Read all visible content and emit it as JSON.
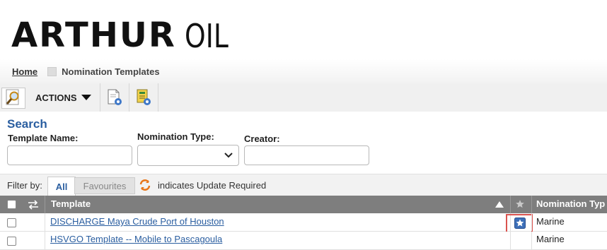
{
  "brand": {
    "name_bold": "ARTHUR",
    "name_light": "OIL"
  },
  "breadcrumb": {
    "home": "Home",
    "current": "Nomination Templates"
  },
  "toolbar": {
    "actions_label": "ACTIONS"
  },
  "search": {
    "title": "Search",
    "template_name_label": "Template Name:",
    "template_name_value": "",
    "nomination_type_label": "Nomination Type:",
    "nomination_type_value": "",
    "creator_label": "Creator:",
    "creator_value": ""
  },
  "filter": {
    "label": "Filter by:",
    "all": "All",
    "favourites": "Favourites",
    "update_note": "indicates Update Required"
  },
  "table": {
    "columns": {
      "template": "Template",
      "nomination_type": "Nomination Typ"
    },
    "rows": [
      {
        "template": "DISCHARGE Maya Crude Port of Houston",
        "nomination_type": "Marine",
        "favourite": true
      },
      {
        "template": "HSVGO Template -- Mobile to Pascagoula",
        "nomination_type": "Marine",
        "favourite": false
      }
    ]
  },
  "colors": {
    "accent": "#2a5ea0",
    "header_bg": "#7e7e7e",
    "highlight": "#d9534f"
  }
}
